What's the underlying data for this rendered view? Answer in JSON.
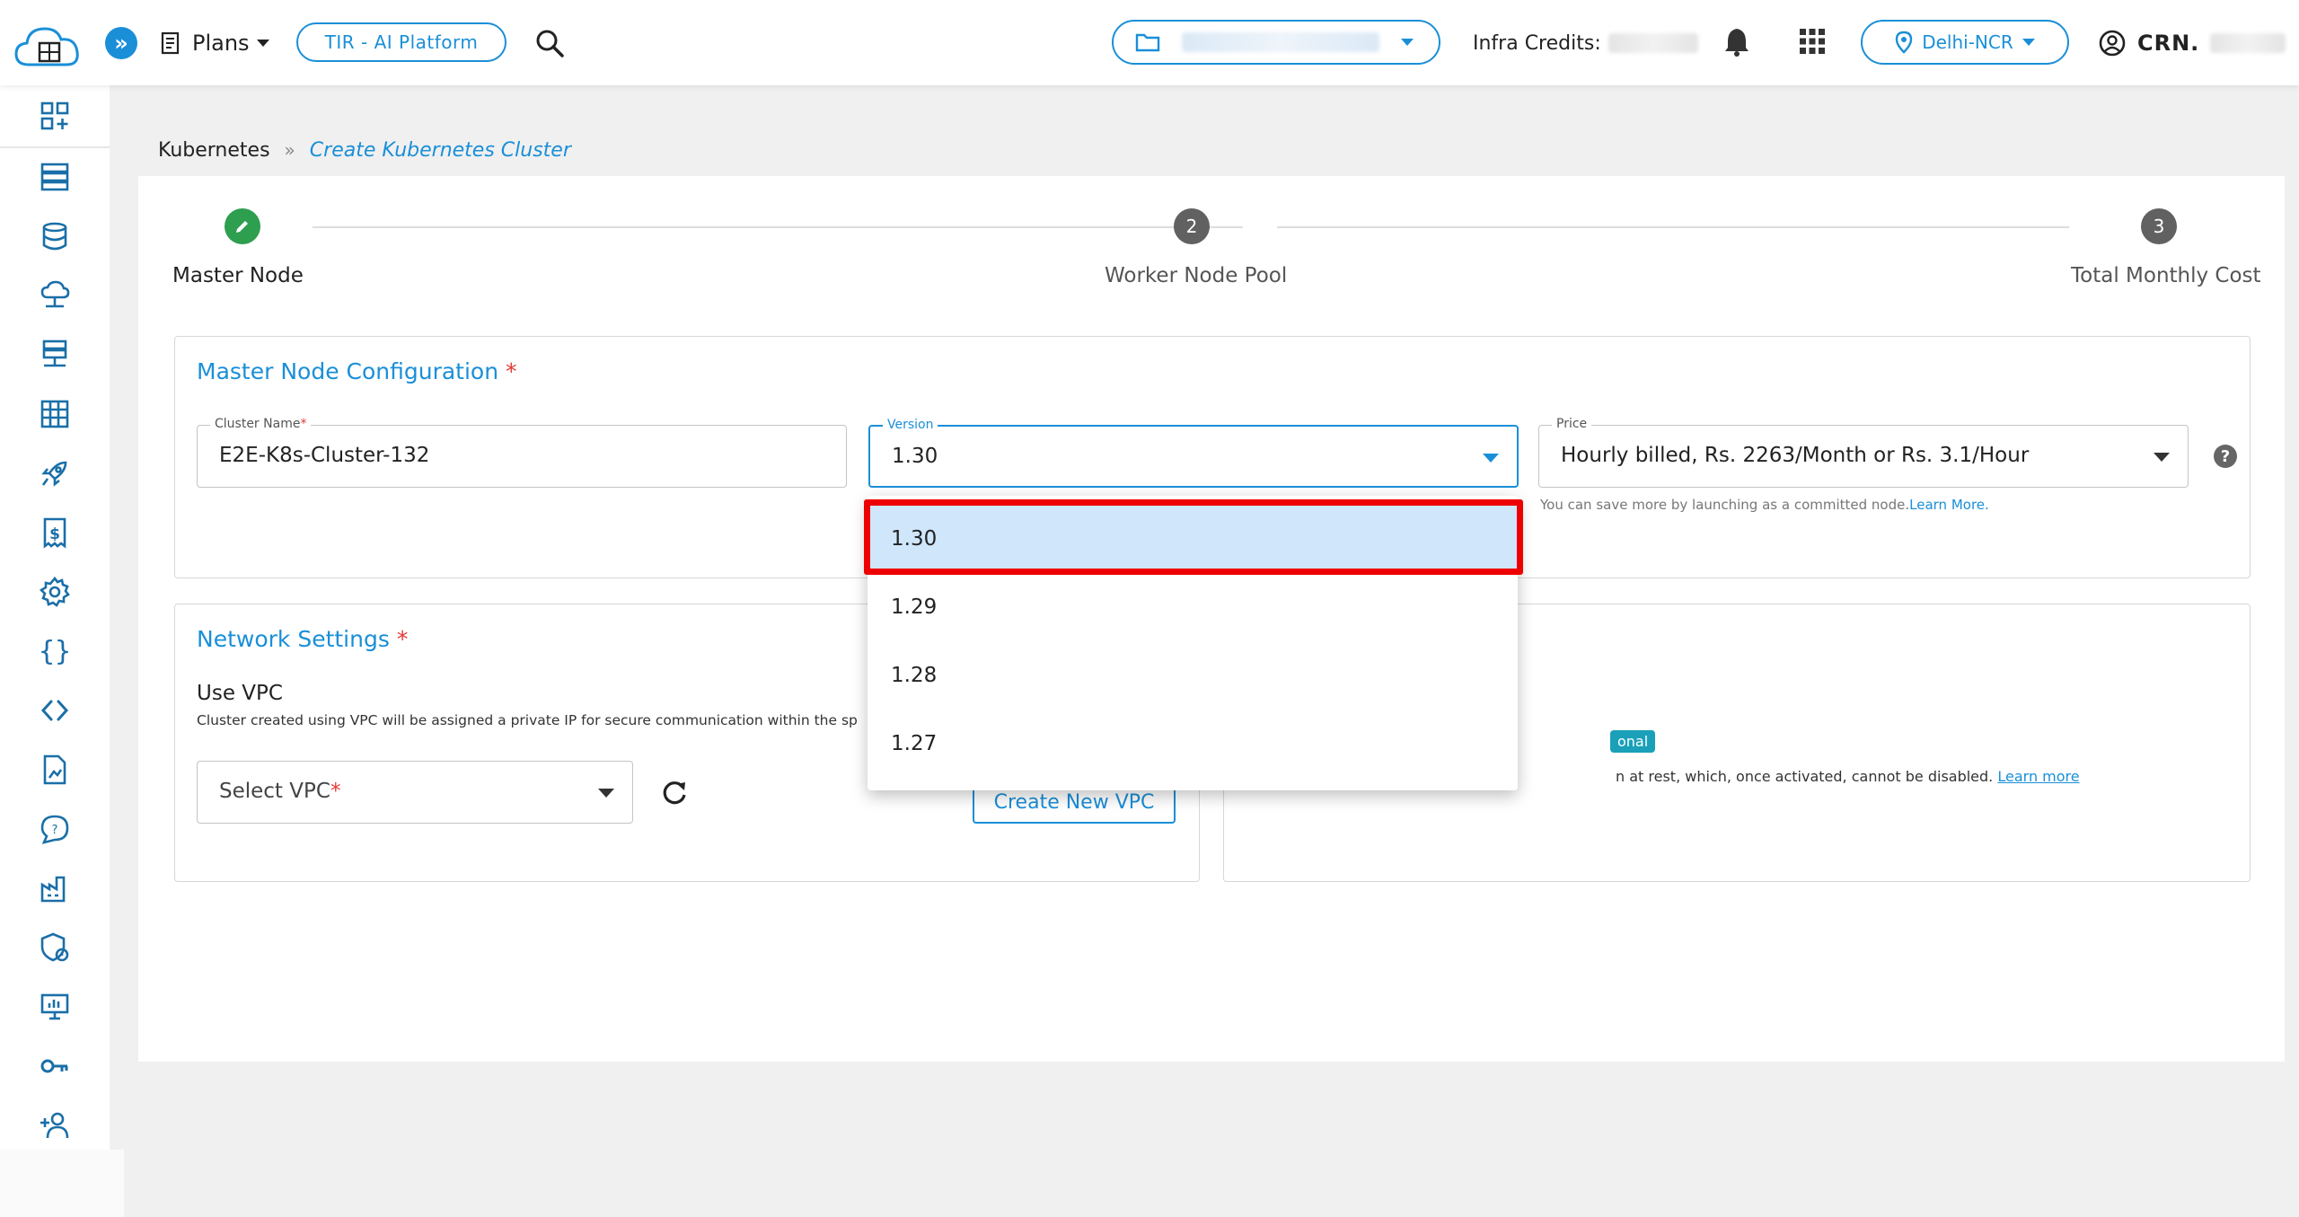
{
  "topbar": {
    "logo_text": "E2E Cloud",
    "plans_label": "Plans",
    "tir_label": "TIR - AI Platform",
    "infra_credits_label": "Infra Credits:",
    "region_label": "Delhi-NCR",
    "account_label": "CRN."
  },
  "sidebar": {
    "icons": [
      "dashboard-add-icon",
      "servers-icon",
      "database-icon",
      "cloud-network-icon",
      "hosting-icon",
      "grid-icon",
      "rocket-icon",
      "billing-icon",
      "settings-gear-icon",
      "code-braces-icon",
      "code-angle-icon",
      "document-chart-icon",
      "support-chat-icon",
      "factory-icon",
      "security-shield-icon",
      "monitor-icon",
      "key-icon",
      "add-user-icon"
    ]
  },
  "breadcrumb": {
    "parent": "Kubernetes",
    "separator": "»",
    "current": "Create Kubernetes Cluster"
  },
  "stepper": {
    "steps": [
      {
        "number": "1",
        "label": "Master Node",
        "state": "done"
      },
      {
        "number": "2",
        "label": "Worker Node Pool",
        "state": "pending"
      },
      {
        "number": "3",
        "label": "Total Monthly Cost",
        "state": "pending"
      }
    ]
  },
  "master_config": {
    "title": "Master Node Configuration",
    "required_mark": "*",
    "cluster_name_label": "Cluster Name",
    "cluster_name_value": "E2E-K8s-Cluster-132",
    "version_label": "Version",
    "version_value": "1.30",
    "price_label": "Price",
    "price_value": "Hourly billed, Rs. 2263/Month or Rs. 3.1/Hour",
    "price_hint": "You can save more by launching as a committed node.",
    "price_hint_link": "Learn More."
  },
  "network": {
    "title": "Network Settings",
    "required_mark": "*",
    "use_vpc_label": "Use VPC",
    "use_vpc_desc": "Cluster created using VPC will be assigned a private IP for secure communication within the sp",
    "select_vpc_placeholder": "Select VPC",
    "create_vpc_button": "Create New VPC"
  },
  "encryption": {
    "badge": "onal",
    "desc": "n at rest, which, once activated, cannot be disabled.",
    "learn_more": "Learn more"
  },
  "version_dropdown": {
    "options": [
      "1.30",
      "1.29",
      "1.28",
      "1.27"
    ],
    "selected": "1.30"
  },
  "colors": {
    "accent": "#1a8fd8",
    "success": "#2e9e4f",
    "highlight": "#ee0000",
    "selected_bg": "#cfe6fb"
  }
}
